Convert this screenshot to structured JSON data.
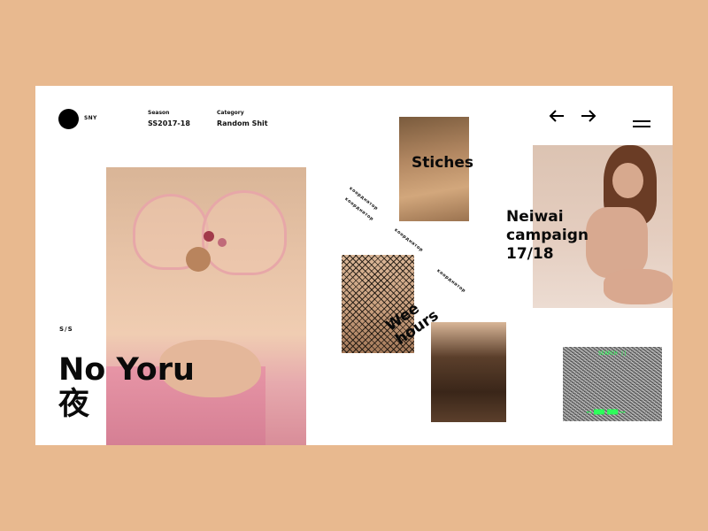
{
  "brand": {
    "name": "SNY"
  },
  "meta": {
    "season_label": "Season",
    "season_value": "SS2017-18",
    "category_label": "Category",
    "category_value": "Random Shit"
  },
  "nav": {
    "prev_icon": "arrow-left-icon",
    "next_icon": "arrow-right-icon",
    "menu_icon": "hamburger-menu-icon"
  },
  "hero": {
    "kicker": "S/S",
    "title": "No Yoru",
    "kanji": "夜"
  },
  "tiles": {
    "stiches": "Stiches",
    "neiwai": [
      "Neiwai",
      "campaign",
      "17/18"
    ],
    "wee_hours": [
      "Wee",
      "hours"
    ]
  },
  "diagonal_texts": [
    "коорднатор",
    "коорднатор",
    "коорднатор",
    "коорднатор"
  ],
  "tv": {
    "top_text": "SEARCH ||",
    "bottom_text": "◄◄ ████ ████ ►►"
  },
  "colors": {
    "background": "#e8b98f",
    "card": "#ffffff",
    "accent_text": "#0a0a0a",
    "tv_text": "#2cff5a"
  }
}
